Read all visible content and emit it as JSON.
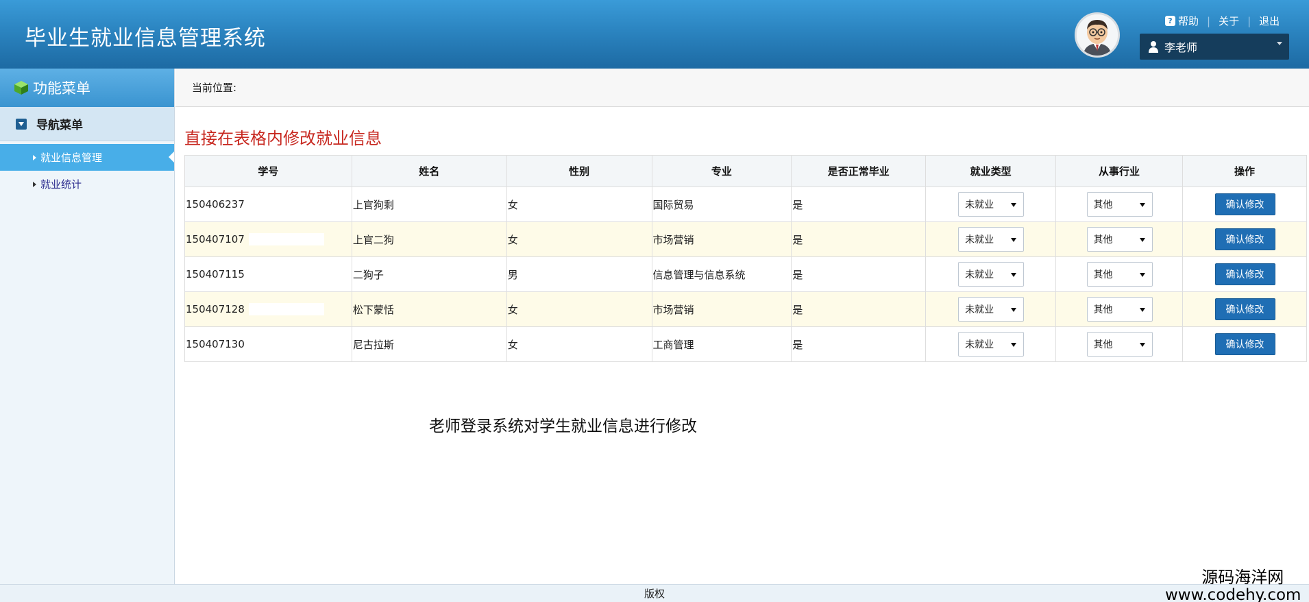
{
  "header": {
    "title": "毕业生就业信息管理系统",
    "links": {
      "help": "帮助",
      "about": "关于",
      "logout": "退出"
    },
    "user": "李老师"
  },
  "sidebar": {
    "title": "功能菜单",
    "nav_title": "导航菜单",
    "items": [
      {
        "label": "就业信息管理",
        "active": true
      },
      {
        "label": "就业统计",
        "active": false
      }
    ]
  },
  "breadcrumb": "当前位置:",
  "page_heading": "直接在表格内修改就业信息",
  "table": {
    "headers": [
      "学号",
      "姓名",
      "性别",
      "专业",
      "是否正常毕业",
      "就业类型",
      "从事行业",
      "操作"
    ],
    "rows": [
      {
        "id": "150406237",
        "name": "上官狗剩",
        "gender": "女",
        "major": "国际贸易",
        "graduated": "是",
        "employment": "未就业",
        "industry": "其他",
        "action": "确认修改"
      },
      {
        "id": "150407107",
        "name": "上官二狗",
        "gender": "女",
        "major": "市场营销",
        "graduated": "是",
        "employment": "未就业",
        "industry": "其他",
        "action": "确认修改"
      },
      {
        "id": "150407115",
        "name": "二狗子",
        "gender": "男",
        "major": "信息管理与信息系统",
        "graduated": "是",
        "employment": "未就业",
        "industry": "其他",
        "action": "确认修改"
      },
      {
        "id": "150407128",
        "name": "松下蒙恬",
        "gender": "女",
        "major": "市场营销",
        "graduated": "是",
        "employment": "未就业",
        "industry": "其他",
        "action": "确认修改"
      },
      {
        "id": "150407130",
        "name": "尼古拉斯",
        "gender": "女",
        "major": "工商管理",
        "graduated": "是",
        "employment": "未就业",
        "industry": "其他",
        "action": "确认修改"
      }
    ]
  },
  "caption": "老师登录系统对学生就业信息进行修改",
  "footer": "版权",
  "watermark": {
    "cn": "源码海洋网",
    "en": "www.codehy.com"
  },
  "colors": {
    "header": "#2b84c0",
    "heading": "#c7271f",
    "button": "#1f6eb4",
    "active_nav": "#48aee8"
  },
  "icons": {
    "avatar": "cartoon-teacher-avatar-icon",
    "user": "user-icon",
    "help": "help-icon",
    "menu": "cube-icon"
  }
}
